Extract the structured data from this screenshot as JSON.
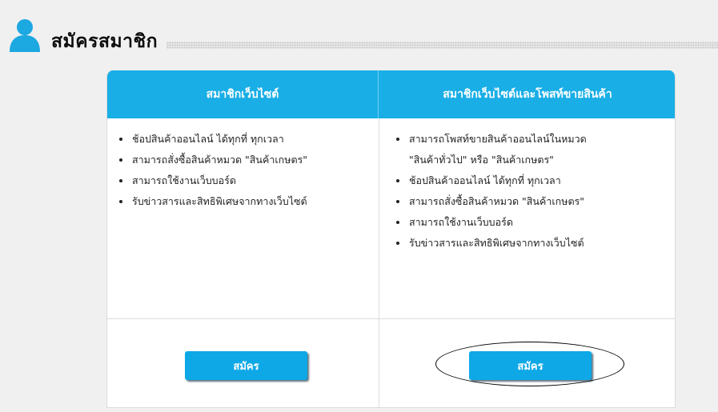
{
  "page": {
    "title": "สมัครสมาชิก"
  },
  "plans": [
    {
      "heading": "สมาชิกเว็บไซต์",
      "features": [
        "ช้อปสินค้าออนไลน์ ได้ทุกที่ ทุกเวลา",
        "สามารถสั่งซื้อสินค้าหมวด \"สินค้าเกษตร\"",
        "สามารถใช้งานเว็บบอร์ด",
        "รับข่าวสารและสิทธิพิเศษจากทางเว็บไซต์"
      ],
      "button_label": "สมัคร"
    },
    {
      "heading": "สมาชิกเว็บไซต์และโพสท์ขายสินค้า",
      "features": [
        "สามารถโพสท์ขายสินค้าออนไลน์ในหมวด",
        "\"สินค้าทั่วไป\" หรือ \"สินค้าเกษตร\"",
        "ช้อปสินค้าออนไลน์ ได้ทุกที่ ทุกเวลา",
        "สามารถสั่งซื้อสินค้าหมวด \"สินค้าเกษตร\"",
        "สามารถใช้งานเว็บบอร์ด",
        "รับข่าวสารและสิทธิพิเศษจากทางเว็บไซต์"
      ],
      "button_label": "สมัคร"
    }
  ],
  "colors": {
    "accent": "#19aee6",
    "button": "#0ea8e6",
    "background": "#f0f0f0"
  },
  "icons": {
    "header": "user-icon"
  }
}
